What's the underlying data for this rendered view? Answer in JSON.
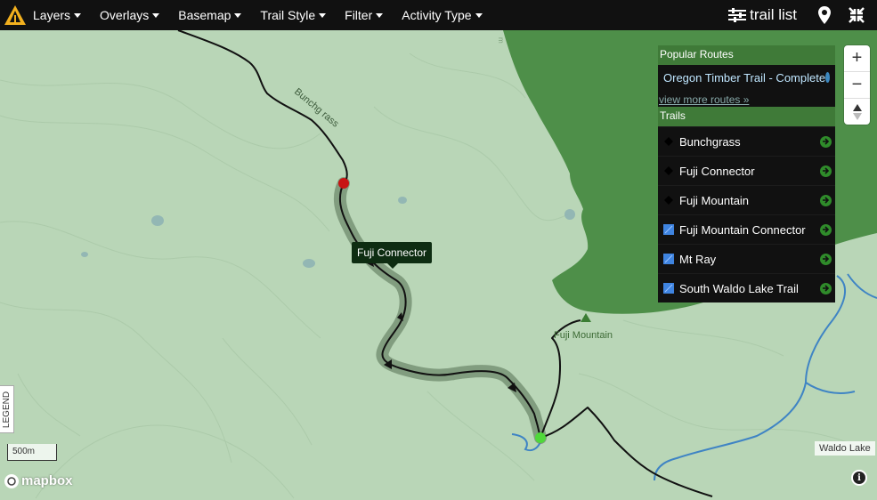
{
  "topbar": {
    "menus": [
      {
        "label": "Layers"
      },
      {
        "label": "Overlays"
      },
      {
        "label": "Basemap"
      },
      {
        "label": "Trail Style"
      },
      {
        "label": "Filter"
      },
      {
        "label": "Activity Type"
      }
    ],
    "trail_list_label": "trail list"
  },
  "panel": {
    "popular_routes_heading": "Popular Routes",
    "route_name": "Oregon Timber Trail - Complete",
    "view_more": "view more routes »",
    "trails_heading": "Trails",
    "trails": [
      {
        "label": "Bunchgrass",
        "symbol": "black-diamond"
      },
      {
        "label": "Fuji Connector",
        "symbol": "black-diamond"
      },
      {
        "label": "Fuji Mountain",
        "symbol": "black-diamond"
      },
      {
        "label": "Fuji Mountain Connector",
        "symbol": "blue-square"
      },
      {
        "label": "Mt Ray",
        "symbol": "blue-square"
      },
      {
        "label": "South Waldo Lake Trail",
        "symbol": "blue-square"
      }
    ]
  },
  "map": {
    "tooltip": "Fuji Connector",
    "trail_label_bunchgrass": "Bunchg rass",
    "peak_label": "Fuji Mountain",
    "place_label": "Waldo Lake",
    "scale_label": "500m",
    "legend_label": "LEGEND",
    "attribution": "mapbox",
    "contour_label": "m",
    "colors": {
      "background": "#b9d6b7",
      "forest": "#4e8f49",
      "water": "#3f84c4",
      "trail_highlight": "#6f8a6c",
      "start_marker": "#c81414",
      "end_marker": "#4fd83a",
      "topbar": "#111111"
    }
  }
}
